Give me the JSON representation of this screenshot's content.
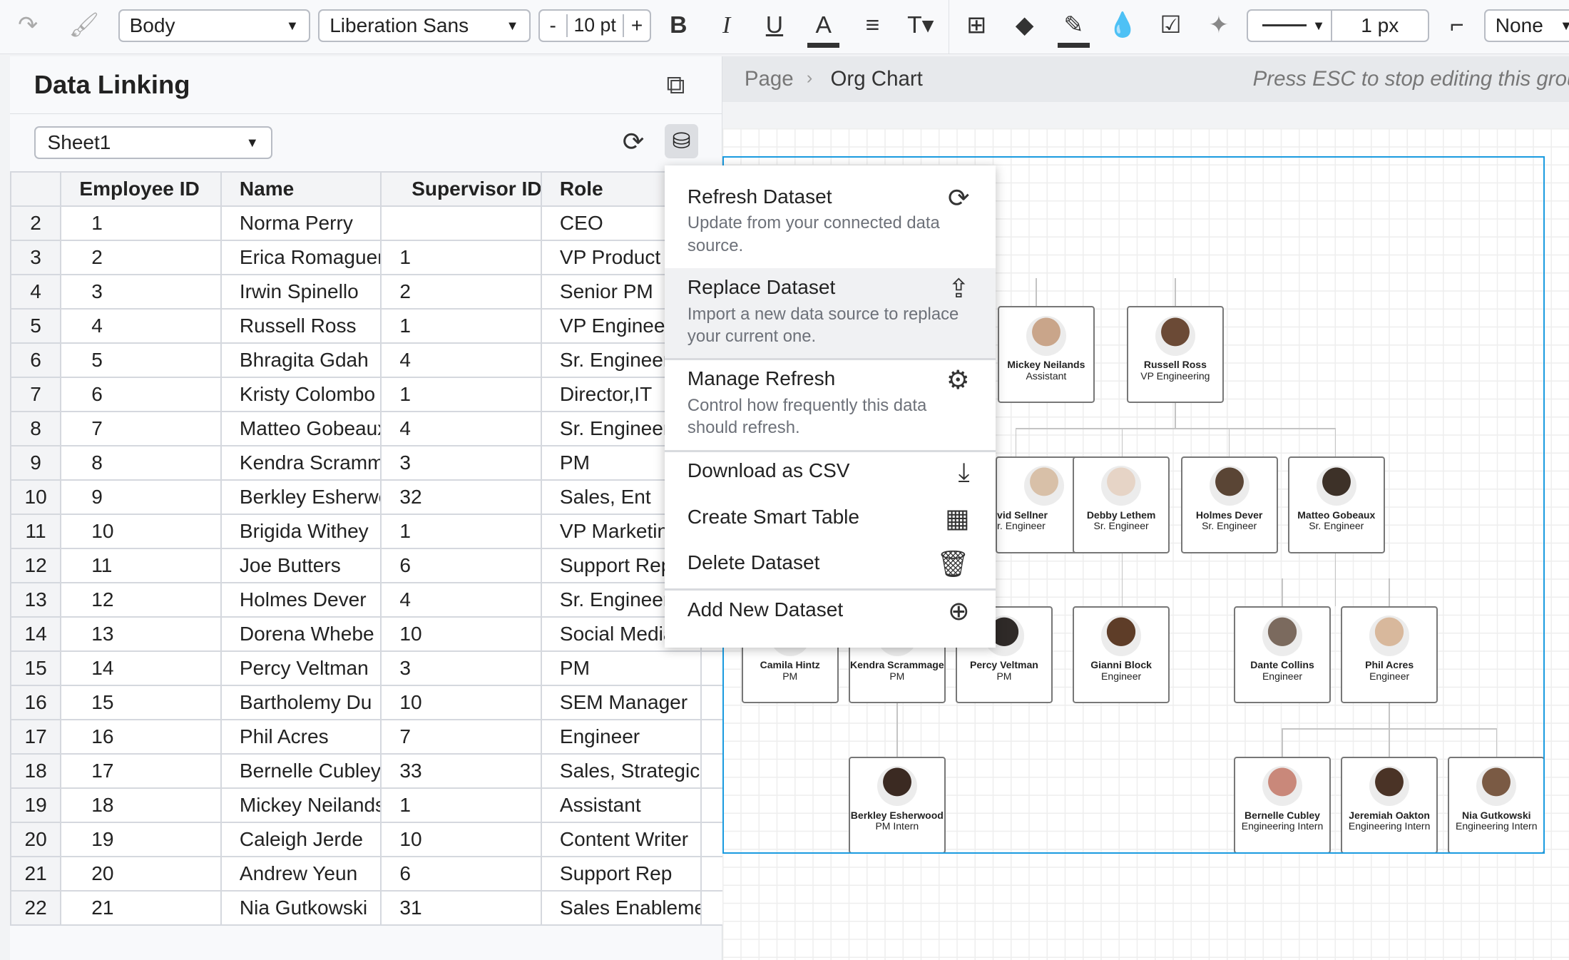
{
  "toolbar": {
    "text_style": "Body",
    "font": "Liberation Sans",
    "font_size": "10 pt",
    "line_width": "1 px",
    "arrow": "None",
    "minus": "-",
    "plus": "+"
  },
  "panel": {
    "title": "Data Linking",
    "sheet": "Sheet1",
    "columns": [
      "",
      "Employee ID",
      "Name",
      "Supervisor ID",
      "Role",
      ""
    ],
    "rows": [
      [
        "2",
        "1",
        "Norma Perry",
        "",
        "CEO"
      ],
      [
        "3",
        "2",
        "Erica Romaguera",
        "1",
        "VP Product"
      ],
      [
        "4",
        "3",
        "Irwin Spinello",
        "2",
        "Senior PM"
      ],
      [
        "5",
        "4",
        "Russell Ross",
        "1",
        "VP Engineering"
      ],
      [
        "6",
        "5",
        "Bhragita Gdah",
        "4",
        "Sr. Engineer"
      ],
      [
        "7",
        "6",
        "Kristy Colombo",
        "1",
        "Director,IT"
      ],
      [
        "8",
        "7",
        "Matteo Gobeaux",
        "4",
        "Sr. Engineer"
      ],
      [
        "9",
        "8",
        "Kendra Scrammage",
        "3",
        "PM"
      ],
      [
        "10",
        "9",
        "Berkley Esherwood",
        "32",
        "Sales, Ent"
      ],
      [
        "11",
        "10",
        "Brigida Withey",
        "1",
        "VP Marketing"
      ],
      [
        "12",
        "11",
        "Joe Butters",
        "6",
        "Support Rep"
      ],
      [
        "13",
        "12",
        "Holmes Dever",
        "4",
        "Sr. Engineer"
      ],
      [
        "14",
        "13",
        "Dorena Whebe",
        "10",
        "Social Media"
      ],
      [
        "15",
        "14",
        "Percy Veltman",
        "3",
        "PM"
      ],
      [
        "16",
        "15",
        "Bartholemy Du",
        "10",
        "SEM Manager"
      ],
      [
        "17",
        "16",
        "Phil Acres",
        "7",
        "Engineer"
      ],
      [
        "18",
        "17",
        "Bernelle Cubley",
        "33",
        "Sales, Strategic"
      ],
      [
        "19",
        "18",
        "Mickey Neilands",
        "1",
        "Assistant"
      ],
      [
        "20",
        "19",
        "Caleigh Jerde",
        "10",
        "Content Writer"
      ],
      [
        "21",
        "20",
        "Andrew Yeun",
        "6",
        "Support Rep"
      ],
      [
        "22",
        "21",
        "Nia Gutkowski",
        "31",
        "Sales Enablement"
      ]
    ]
  },
  "breadcrumb": {
    "page": "Page",
    "sep": "›",
    "current": "Org Chart",
    "hint": "Press ESC to stop editing this group"
  },
  "menu": [
    {
      "label": "Refresh Dataset",
      "desc": "Update from your connected data source.",
      "icon": "refresh-icon"
    },
    {
      "label": "Replace Dataset",
      "desc": "Import a new data source to replace your current one.",
      "icon": "upload-icon"
    },
    {
      "label": "Manage Refresh",
      "desc": "Control how frequently this data should refresh.",
      "icon": "gear-icon"
    },
    {
      "label": "Download as CSV",
      "icon": "download-icon"
    },
    {
      "label": "Create Smart Table",
      "icon": "table-icon"
    },
    {
      "label": "Delete Dataset",
      "icon": "trash-icon"
    },
    {
      "label": "Add New Dataset",
      "icon": "plus-circle-icon"
    }
  ],
  "org": [
    {
      "name": "Mickey Neilands",
      "title": "Assistant"
    },
    {
      "name": "Russell Ross",
      "title": "VP Engineering"
    },
    {
      "name": "vid Sellner",
      "title": "r. Engineer"
    },
    {
      "name": "Debby Lethem",
      "title": "Sr. Engineer"
    },
    {
      "name": "Holmes Dever",
      "title": "Sr. Engineer"
    },
    {
      "name": "Matteo Gobeaux",
      "title": "Sr. Engineer"
    },
    {
      "name": "Camila Hintz",
      "title": "PM"
    },
    {
      "name": "Kendra Scrammage",
      "title": "PM"
    },
    {
      "name": "Percy Veltman",
      "title": "PM"
    },
    {
      "name": "Gianni Block",
      "title": "Engineer"
    },
    {
      "name": "Dante Collins",
      "title": "Engineer"
    },
    {
      "name": "Phil Acres",
      "title": "Engineer"
    },
    {
      "name": "Berkley Esherwood",
      "title": "PM Intern"
    },
    {
      "name": "Bernelle Cubley",
      "title": "Engineering Intern"
    },
    {
      "name": "Jeremiah Oakton",
      "title": "Engineering Intern"
    },
    {
      "name": "Nia Gutkowski",
      "title": "Engineering Intern"
    }
  ],
  "colors": {
    "selection": "#1a9be0",
    "highlight": "#f0f1f3"
  }
}
